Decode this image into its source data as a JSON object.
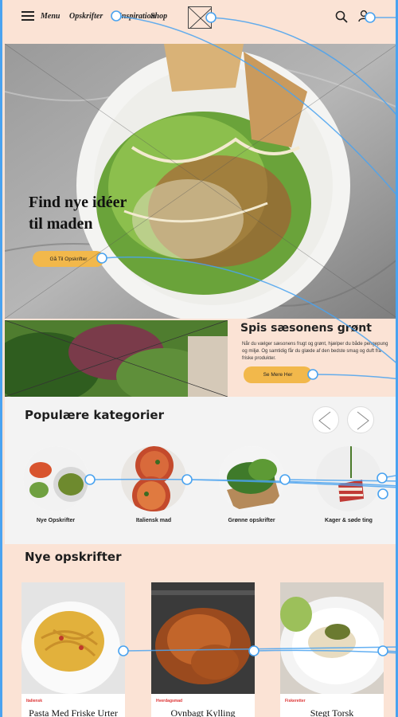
{
  "header": {
    "nav": [
      "Menu",
      "Opskrifter",
      "Inspiration",
      "Shop"
    ],
    "menu_icon": "hamburger-icon",
    "search_icon": "search-icon",
    "user_icon": "user-icon"
  },
  "hero": {
    "title_line1": "Find nye idéer",
    "title_line2": "til maden",
    "button": "Gå Til Opskrifter"
  },
  "season": {
    "title": "Spis sæsonens grønt",
    "body": "Når du vælger sæsonens frugt og grønt, hjælper du både pengepung og miljø. Og samtidig får du glæde af den bedste smag og duft fra friske produkter.",
    "button": "Se Mere Her"
  },
  "popular": {
    "title": "Populære kategorier",
    "categories": [
      {
        "label": "Nye Opskrifter"
      },
      {
        "label": "Italiensk mad"
      },
      {
        "label": "Grønne opskrifter"
      },
      {
        "label": "Kager & søde ting"
      }
    ]
  },
  "new_recipes": {
    "title": "Nye opskrifter",
    "cards": [
      {
        "tag": "Italiensk",
        "title": "Pasta Med Friske Urter"
      },
      {
        "tag": "Hverdagsmad",
        "title": "Ovnbagt Kylling"
      },
      {
        "tag": "Fiskeretter",
        "title": "Stegt Torsk"
      }
    ]
  },
  "colors": {
    "accent": "#f2b84b",
    "background": "#fbe3d5",
    "wireframe_lines": "#4aa3f0"
  }
}
